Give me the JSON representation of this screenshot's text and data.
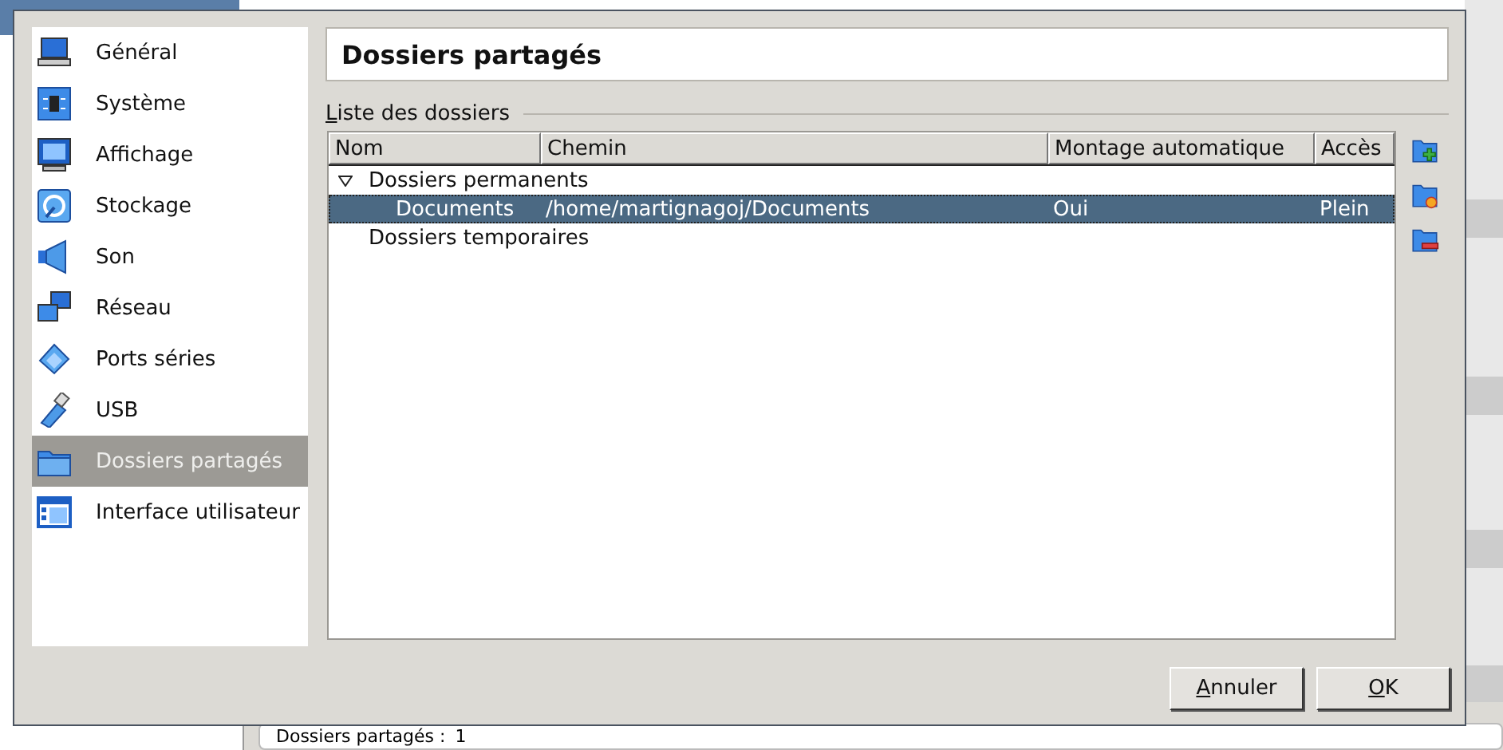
{
  "background_window": {
    "status_label": "Dossiers partagés :",
    "status_value": "1"
  },
  "sidebar": {
    "items": [
      {
        "label": "Général",
        "selected": false
      },
      {
        "label": "Système",
        "selected": false
      },
      {
        "label": "Affichage",
        "selected": false
      },
      {
        "label": "Stockage",
        "selected": false
      },
      {
        "label": "Son",
        "selected": false
      },
      {
        "label": "Réseau",
        "selected": false
      },
      {
        "label": "Ports séries",
        "selected": false
      },
      {
        "label": "USB",
        "selected": false
      },
      {
        "label": "Dossiers partagés",
        "selected": true
      },
      {
        "label": "Interface utilisateur",
        "selected": false
      }
    ]
  },
  "page_title": "Dossiers partagés",
  "folder_list": {
    "label": "Liste des dossiers",
    "columns": [
      "Nom",
      "Chemin",
      "Montage automatique",
      "Accès"
    ],
    "groups": [
      {
        "label": "Dossiers permanents",
        "expanded": true,
        "children": [
          {
            "name": "Documents",
            "path": "/home/martignagoj/Documents",
            "auto_mount": "Oui",
            "access": "Plein",
            "selected": true
          }
        ]
      },
      {
        "label": "Dossiers temporaires",
        "expanded": false
      }
    ]
  },
  "buttons": [
    "Annuler",
    "OK"
  ]
}
